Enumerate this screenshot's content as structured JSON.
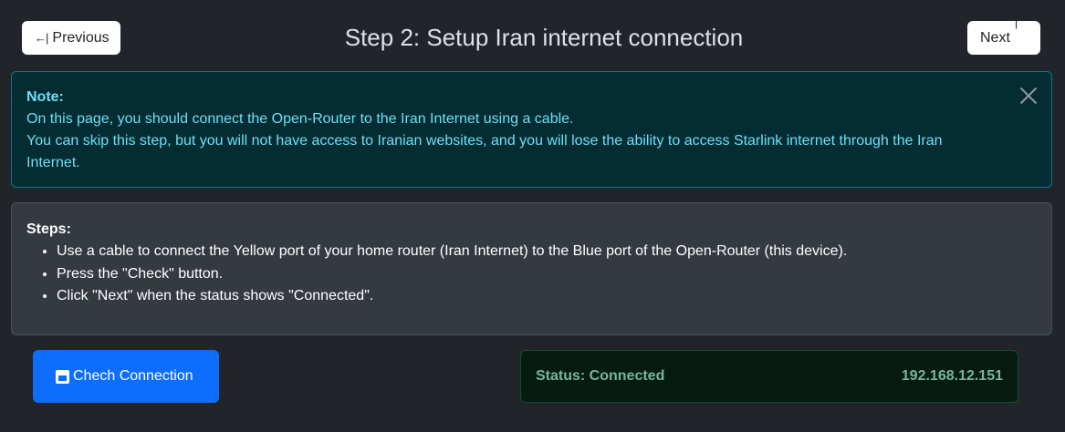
{
  "header": {
    "previous_label": "Previous",
    "previous_glyph": "←|",
    "next_label": "Next",
    "next_glyph": "|→",
    "title": "Step 2: Setup Iran internet connection"
  },
  "note": {
    "title": "Note:",
    "lines": [
      "On this page, you should connect the Open-Router to the Iran Internet using a cable.",
      "You can skip this step, but you will not have access to Iranian websites, and you will lose the ability to access Starlink internet through the Iran Internet."
    ],
    "close_icon": "close-icon"
  },
  "steps": {
    "title": "Steps:",
    "items": [
      "Use a cable to connect the Yellow port of your home router (Iran Internet) to the Blue port of the Open-Router (this device).",
      "Press the \"Check\" button.",
      "Click \"Next\" when the status shows \"Connected\"."
    ]
  },
  "check": {
    "label": "Chech Connection",
    "icon": "ethernet-icon"
  },
  "status": {
    "label": "Status: Connected",
    "ip": "192.168.12.151"
  },
  "colors": {
    "background": "#212529",
    "alert_bg": "#042c33",
    "alert_text": "#6edff6",
    "primary": "#0d6efd",
    "success_text": "#75b798"
  }
}
